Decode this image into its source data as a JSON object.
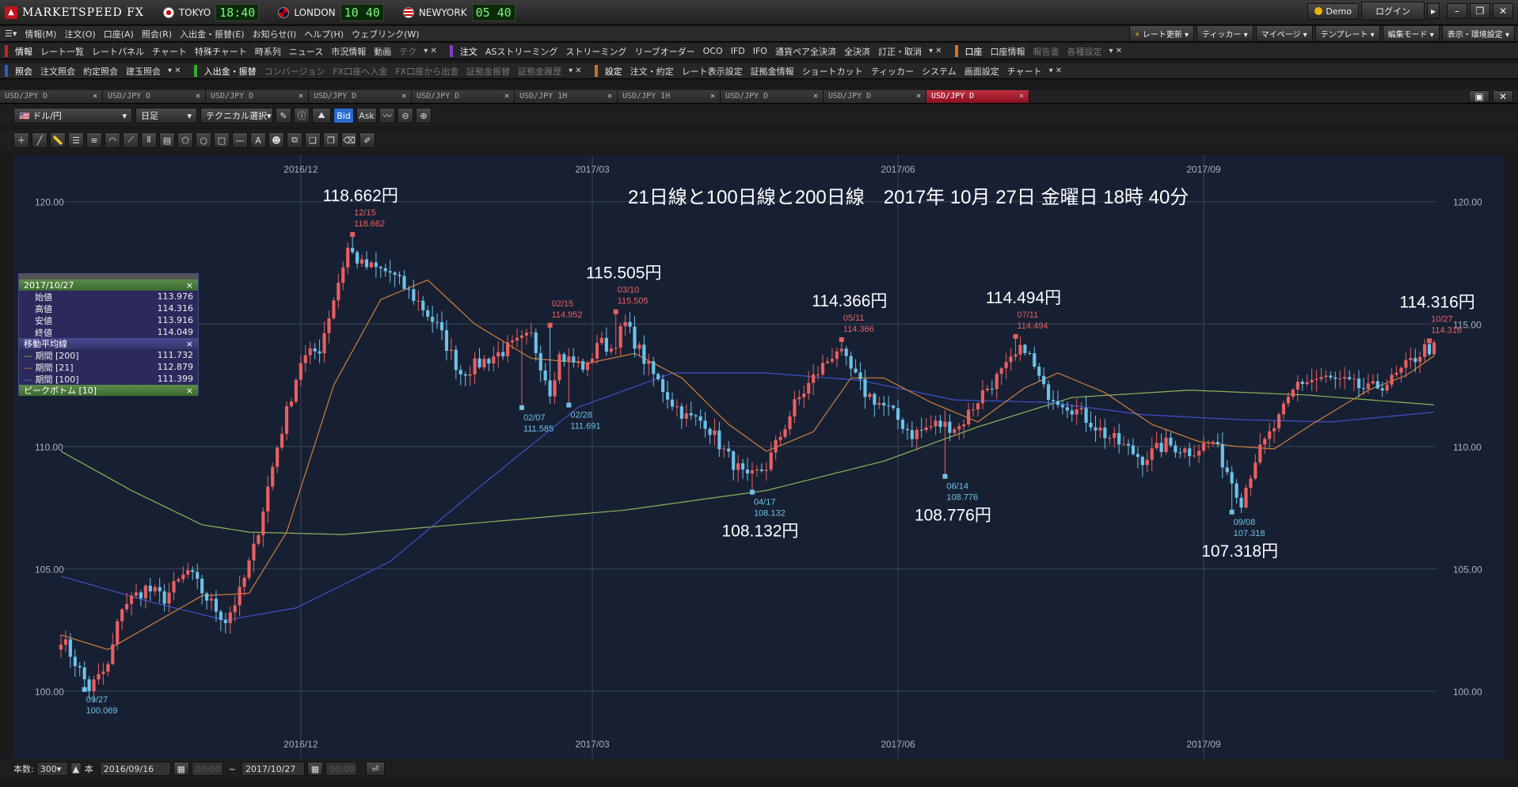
{
  "app": {
    "logo_text": "MARKETSPEED FX",
    "markets": [
      {
        "name": "TOKYO",
        "time": "18:40"
      },
      {
        "name": "LONDON",
        "time": "10 40"
      },
      {
        "name": "NEWYORK",
        "time": "05 40"
      }
    ],
    "demo_label": "Demo",
    "login_label": "ログイン",
    "window_buttons": [
      "▸",
      "–",
      "❐",
      "✕"
    ]
  },
  "menubar": {
    "items": [
      "情報(M)",
      "注文(O)",
      "口座(A)",
      "照会(R)",
      "入出金・振替(E)",
      "お知らせ(I)",
      "ヘルプ(H)",
      "ウェブリンク(W)"
    ],
    "right_buttons": [
      "レート更新",
      "ティッカー",
      "マイページ",
      "テンプレート",
      "編集モード",
      "表示・環境設定"
    ]
  },
  "toolbar1": {
    "groups": [
      {
        "color": "#d02020",
        "items": [
          "情報",
          "レート一覧",
          "レートパネル",
          "チャート",
          "特殊チャート",
          "時系列",
          "ニュース",
          "市況情報",
          "動画",
          "テク"
        ]
      },
      {
        "color": "#8040c0",
        "items": [
          "注文",
          "ASストリーミング",
          "ストリーミング",
          "リーブオーダー",
          "OCO",
          "IFD",
          "IFO",
          "通貨ペア全決済",
          "全決済",
          "訂正・取消"
        ]
      },
      {
        "color": "#e07020",
        "items": [
          "口座",
          "口座情報",
          "報告書",
          "各種設定"
        ]
      }
    ]
  },
  "toolbar2": {
    "groups": [
      {
        "color": "#2060d0",
        "items": [
          "照会",
          "注文照会",
          "約定照会",
          "建玉照会"
        ]
      },
      {
        "color": "#30b030",
        "items": [
          "入出金・振替",
          "コンバージョン",
          "FX口座へ入金",
          "FX口座から出金",
          "証拠金振替",
          "証拠金履歴"
        ]
      },
      {
        "color": "#d07020",
        "items": [
          "設定",
          "注文・約定",
          "レート表示設定",
          "証拠金情報",
          "ショートカット",
          "ティッカー",
          "システム",
          "画面設定",
          "チャート"
        ]
      }
    ]
  },
  "tabs": [
    {
      "label": "USD/JPY D"
    },
    {
      "label": "USD/JPY D"
    },
    {
      "label": "USD/JPY D"
    },
    {
      "label": "USD/JPY D"
    },
    {
      "label": "USD/JPY D"
    },
    {
      "label": "USD/JPY 1H"
    },
    {
      "label": "USD/JPY 1H"
    },
    {
      "label": "USD/JPY D"
    },
    {
      "label": "USD/JPY D"
    },
    {
      "label": "USD/JPY D",
      "active": true
    }
  ],
  "chart_controls": {
    "pair": "ドル/円",
    "period": "日足",
    "technical": "テクニカル選択",
    "bid": "Bid",
    "ask": "Ask"
  },
  "footer": {
    "count_label": "本数:",
    "count_value": "300",
    "unit": "本",
    "from_date": "2016/09/16",
    "from_time": "00:00",
    "tilde": "~",
    "to_date": "2017/10/27",
    "to_time": "00:00"
  },
  "info_panel": {
    "date": "2017/10/27",
    "open_label": "始値",
    "open": "113.976",
    "high_label": "高値",
    "high": "114.316",
    "low_label": "安値",
    "low": "113.916",
    "close_label": "終値",
    "close": "114.049",
    "ma_header": "移動平均線",
    "ma200_label": "期間 [200]",
    "ma200": "111.732",
    "ma21_label": "期間 [21]",
    "ma21": "112.879",
    "ma100_label": "期間 [100]",
    "ma100": "111.399",
    "peak_header": "ピークボトム [10]"
  },
  "colors": {
    "up": "#e86060",
    "down": "#6ec1e8",
    "ma21": "#d0803a",
    "ma100": "#4050c8",
    "ma200": "#8ab85a",
    "peak": "#e86060",
    "bottom": "#6ec1e8"
  },
  "chart_data": {
    "type": "candlestick",
    "title": "21日線と100日線と200日線　2017年 10月 27日 金曜日 18時 40分",
    "y_ticks": [
      "120.00",
      "115.00",
      "110.00",
      "105.00",
      "100.00"
    ],
    "ylim": [
      97.25,
      121.9
    ],
    "x_ticks": [
      {
        "label": "2016/12",
        "idx": 51
      },
      {
        "label": "2017/03",
        "idx": 113
      },
      {
        "label": "2017/06",
        "idx": 178
      },
      {
        "label": "2017/09",
        "idx": 243
      }
    ],
    "anchors": [
      [
        0,
        102.2
      ],
      [
        3,
        101.2
      ],
      [
        6,
        100.1
      ],
      [
        10,
        101.0
      ],
      [
        13,
        103.5
      ],
      [
        18,
        104.2
      ],
      [
        22,
        103.8
      ],
      [
        27,
        104.9
      ],
      [
        31,
        103.8
      ],
      [
        35,
        102.9
      ],
      [
        38,
        104.0
      ],
      [
        41,
        105.8
      ],
      [
        46,
        110.0
      ],
      [
        51,
        113.5
      ],
      [
        55,
        114.0
      ],
      [
        61,
        118.1
      ],
      [
        64,
        117.4
      ],
      [
        70,
        117.1
      ],
      [
        76,
        115.9
      ],
      [
        80,
        114.9
      ],
      [
        85,
        113.0
      ],
      [
        92,
        113.7
      ],
      [
        100,
        114.5
      ],
      [
        104,
        112.3
      ],
      [
        106,
        113.7
      ],
      [
        112,
        113.2
      ],
      [
        114,
        114.3
      ],
      [
        117,
        114.0
      ],
      [
        120,
        115.0
      ],
      [
        125,
        113.2
      ],
      [
        130,
        111.8
      ],
      [
        133,
        111.2
      ],
      [
        137,
        111.0
      ],
      [
        141,
        109.8
      ],
      [
        146,
        108.6
      ],
      [
        150,
        109.2
      ],
      [
        156,
        111.7
      ],
      [
        160,
        112.8
      ],
      [
        165,
        114.0
      ],
      [
        171,
        112.2
      ],
      [
        176,
        111.5
      ],
      [
        181,
        110.5
      ],
      [
        186,
        110.9
      ],
      [
        191,
        110.8
      ],
      [
        196,
        112.2
      ],
      [
        201,
        113.2
      ],
      [
        205,
        114.1
      ],
      [
        209,
        112.3
      ],
      [
        215,
        111.6
      ],
      [
        219,
        111.0
      ],
      [
        222,
        110.5
      ],
      [
        226,
        110.0
      ],
      [
        230,
        109.5
      ],
      [
        235,
        110.1
      ],
      [
        240,
        109.8
      ],
      [
        245,
        110.2
      ],
      [
        251,
        107.8
      ],
      [
        254,
        109.5
      ],
      [
        259,
        111.1
      ],
      [
        263,
        112.6
      ],
      [
        268,
        112.8
      ],
      [
        273,
        112.6
      ],
      [
        278,
        112.3
      ],
      [
        283,
        112.7
      ],
      [
        290,
        114.0
      ],
      [
        292,
        114.0
      ]
    ],
    "peaks": [
      {
        "idx": 5,
        "date": "09/27",
        "value": "100.069",
        "price": 100.07,
        "type": "bottom",
        "big": ""
      },
      {
        "idx": 62,
        "date": "12/15",
        "value": "118.662",
        "price": 118.66,
        "type": "peak",
        "big": "118.662円"
      },
      {
        "idx": 98,
        "date": "02/07",
        "value": "111.585",
        "price": 111.585,
        "type": "bottom",
        "big": ""
      },
      {
        "idx": 104,
        "date": "02/15",
        "value": "114.952",
        "price": 114.952,
        "type": "peak",
        "big": ""
      },
      {
        "idx": 108,
        "date": "02/28",
        "value": "111.691",
        "price": 111.691,
        "type": "bottom",
        "big": ""
      },
      {
        "idx": 118,
        "date": "03/10",
        "value": "115.505",
        "price": 115.505,
        "type": "peak",
        "big": "115.505円"
      },
      {
        "idx": 147,
        "date": "04/17",
        "value": "108.132",
        "price": 108.132,
        "type": "bottom",
        "big": "108.132円"
      },
      {
        "idx": 166,
        "date": "05/11",
        "value": "114.366",
        "price": 114.366,
        "type": "peak",
        "big": "114.366円"
      },
      {
        "idx": 188,
        "date": "06/14",
        "value": "108.776",
        "price": 108.776,
        "type": "bottom",
        "big": "108.776円"
      },
      {
        "idx": 203,
        "date": "07/11",
        "value": "114.494",
        "price": 114.494,
        "type": "peak",
        "big": "114.494円"
      },
      {
        "idx": 249,
        "date": "09/08",
        "value": "107.318",
        "price": 107.318,
        "type": "bottom",
        "big": "107.318円"
      },
      {
        "idx": 291,
        "date": "10/27",
        "value": "114.316",
        "price": 114.316,
        "type": "peak",
        "big": "114.316円"
      }
    ],
    "ma200": [
      [
        0,
        109.8
      ],
      [
        15,
        108.2
      ],
      [
        30,
        106.8
      ],
      [
        40,
        106.5
      ],
      [
        60,
        106.4
      ],
      [
        90,
        106.9
      ],
      [
        120,
        107.4
      ],
      [
        150,
        108.2
      ],
      [
        175,
        109.4
      ],
      [
        195,
        110.8
      ],
      [
        215,
        112.0
      ],
      [
        240,
        112.3
      ],
      [
        265,
        112.1
      ],
      [
        292,
        111.7
      ]
    ],
    "ma100": [
      [
        0,
        104.7
      ],
      [
        20,
        103.6
      ],
      [
        35,
        102.9
      ],
      [
        50,
        103.4
      ],
      [
        70,
        105.3
      ],
      [
        90,
        108.5
      ],
      [
        110,
        111.6
      ],
      [
        130,
        113.0
      ],
      [
        150,
        113.0
      ],
      [
        170,
        112.7
      ],
      [
        190,
        111.9
      ],
      [
        210,
        111.8
      ],
      [
        230,
        111.3
      ],
      [
        250,
        111.1
      ],
      [
        270,
        111.0
      ],
      [
        292,
        111.4
      ]
    ],
    "ma21": [
      [
        0,
        102.3
      ],
      [
        10,
        101.7
      ],
      [
        20,
        102.8
      ],
      [
        30,
        103.9
      ],
      [
        40,
        104.0
      ],
      [
        48,
        106.5
      ],
      [
        58,
        112.5
      ],
      [
        68,
        116.0
      ],
      [
        78,
        116.8
      ],
      [
        88,
        115.0
      ],
      [
        100,
        113.6
      ],
      [
        112,
        113.4
      ],
      [
        122,
        113.8
      ],
      [
        132,
        112.8
      ],
      [
        142,
        110.9
      ],
      [
        150,
        109.8
      ],
      [
        160,
        110.6
      ],
      [
        168,
        112.8
      ],
      [
        175,
        112.8
      ],
      [
        185,
        111.8
      ],
      [
        195,
        111.0
      ],
      [
        205,
        112.4
      ],
      [
        212,
        113.0
      ],
      [
        222,
        112.2
      ],
      [
        232,
        110.9
      ],
      [
        242,
        110.2
      ],
      [
        250,
        110.0
      ],
      [
        258,
        109.9
      ],
      [
        266,
        110.9
      ],
      [
        278,
        112.3
      ],
      [
        286,
        112.9
      ],
      [
        292,
        113.7
      ]
    ]
  }
}
